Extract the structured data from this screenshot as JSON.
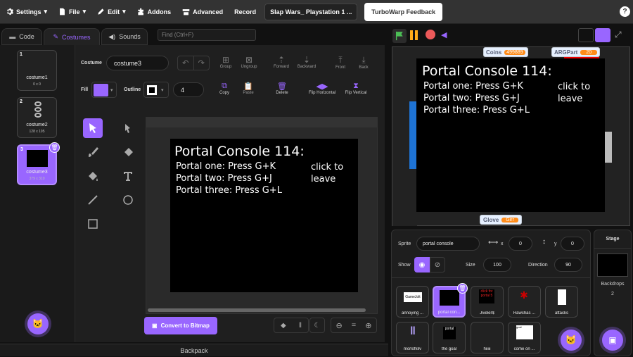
{
  "menubar": {
    "settings": "Settings",
    "file": "File",
    "edit": "Edit",
    "addons": "Addons",
    "advanced": "Advanced",
    "record": "Record",
    "project_title": "Slap Wars_ Playstation 1 ...",
    "feedback": "TurboWarp Feedback",
    "help": "?"
  },
  "tabs": {
    "code": "Code",
    "costumes": "Costumes",
    "sounds": "Sounds"
  },
  "find_placeholder": "Find (Ctrl+F)",
  "costumes": [
    {
      "num": "1",
      "name": "costume1",
      "size": "0 x 0"
    },
    {
      "num": "2",
      "name": "costume2",
      "size": "128 x 195"
    },
    {
      "num": "3",
      "name": "costume3",
      "size": "379 x 310"
    }
  ],
  "editor": {
    "costume_label": "Costume",
    "costume_name": "costume3",
    "group": "Group",
    "ungroup": "Ungroup",
    "forward": "Forward",
    "backward": "Backward",
    "front": "Front",
    "back": "Back",
    "fill_label": "Fill",
    "outline_label": "Outline",
    "outline_size": "4",
    "copy": "Copy",
    "paste": "Paste",
    "delete": "Delete",
    "flip_h": "Flip Horizontal",
    "flip_v": "Flip Vertical",
    "convert": "Convert to Bitmap",
    "fill_color": "#9966ff"
  },
  "console": {
    "title": "Portal Console 114:",
    "line1": "Portal one: Press G+K",
    "line2": "Portal two: Press G+J",
    "line3": "Portal three: Press G+L",
    "leave1": "click to",
    "leave2": "leave"
  },
  "stage_vars": {
    "coins_label": "Coins",
    "coins_value": "499889",
    "argpart_label": "ARGPart",
    "argpart_value": "20",
    "glove_label": "Glove",
    "glove_value": "Girr"
  },
  "sprite_info": {
    "sprite_label": "Sprite",
    "sprite_name": "portal console",
    "x_label": "x",
    "x_value": "0",
    "y_label": "y",
    "y_value": "0",
    "show_label": "Show",
    "size_label": "Size",
    "size_value": "100",
    "direction_label": "Direction",
    "direction_value": "90"
  },
  "sprites": [
    {
      "name": "annoying ..."
    },
    {
      "name": "portal con..."
    },
    {
      "name": "Jiveler$"
    },
    {
      "name": "Rawchas ..."
    },
    {
      "name": "attacks"
    },
    {
      "name": "morlofkilv"
    },
    {
      "name": "the goal"
    },
    {
      "name": "hiiiii"
    },
    {
      "name": "come on ..."
    }
  ],
  "stage_pane": {
    "title": "Stage",
    "backdrops_label": "Backdrops",
    "backdrops_count": "2"
  },
  "backpack": "Backpack",
  "thumb_text": {
    "gamejolt": "GameJolt",
    "clickfor": "click for portal 5",
    "sprite8": "portal",
    "sprite9": "goal"
  }
}
